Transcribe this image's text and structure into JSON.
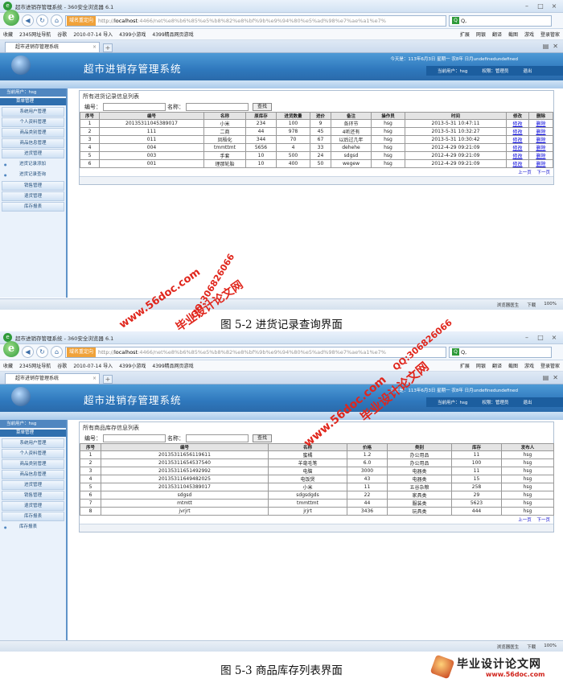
{
  "browser": {
    "window_title": "超市进销存管理系统 - 360安全浏览器 6.1",
    "addr_tag": "域名重定向",
    "addr_prefix": "http://",
    "addr_host": "localhost",
    "addr_path": ":4466/net%e8%b6%85%e5%b8%82%e8%bf%9b%e9%94%80%e5%ad%98%e7%ae%a1%e7%",
    "search_text": "Q,",
    "favorites": [
      "收藏",
      "2345网址导航",
      "谷歌",
      "2010-07-14 导入",
      "4399小游戏",
      "4399精品网页游戏"
    ],
    "toolbar_right": [
      "扩展",
      "网银",
      "翻译",
      "截图",
      "游戏",
      "登录管家"
    ],
    "tab_title": "超市进销存管理系统",
    "status_right": [
      "浏览器医生",
      "下载",
      "100%"
    ]
  },
  "app": {
    "title": "超市进销存管理系统",
    "date_text": "今天是：113年6月3日 星期一 农8年 日月undefinedundefined",
    "current_user": "当前用户：hsg",
    "role": "权限：管理员",
    "logout": "退出",
    "sidebar_head": "当前用户：hsg"
  },
  "shot1": {
    "sidebar": {
      "group": "菜单管理",
      "items_top": [
        "系统用户管理",
        "个人资料管理",
        "商品类别管理",
        "商品信息管理",
        "进货管理"
      ],
      "subs": [
        "进货记录添加",
        "进货记录查询"
      ],
      "items_bottom": [
        "销售管理",
        "退货管理",
        "库存报表"
      ]
    },
    "panel_title": "所有进货记录信息列表",
    "filter_no": "编号：",
    "filter_name": "名称：",
    "search_btn": "查找",
    "headers": [
      "序号",
      "编号",
      "名称",
      "原库存",
      "进货数量",
      "进价",
      "备注",
      "操作员",
      "时间",
      "修改",
      "删除"
    ],
    "rows": [
      [
        "1",
        "20135311045389017",
        "小米",
        "234",
        "100",
        "9",
        "各环节",
        "hsg",
        "2013-5-31 10:47:11",
        "修改",
        "删除"
      ],
      [
        "2",
        "111",
        "二商",
        "44",
        "978",
        "45",
        "4听还有",
        "hsg",
        "2013-5-31 10:32:27",
        "修改",
        "删除"
      ],
      [
        "3",
        "011",
        "凤梧化",
        "344",
        "70",
        "67",
        "以后过几年",
        "hsg",
        "2013-5-31 10:30:42",
        "修改",
        "删除"
      ],
      [
        "4",
        "004",
        "tmmttmt",
        "5656",
        "4",
        "33",
        "dehehe",
        "hsg",
        "2012-4-29 09:21:09",
        "修改",
        "删除"
      ],
      [
        "5",
        "003",
        "手套",
        "10",
        "500",
        "24",
        "sdgsd",
        "hsg",
        "2012-4-29 09:21:09",
        "修改",
        "删除"
      ],
      [
        "6",
        "001",
        "理那轮胎",
        "10",
        "400",
        "50",
        "wegew",
        "hsg",
        "2012-4-29 09:21:09",
        "修改",
        "删除"
      ]
    ],
    "pager": "上一页 下一页",
    "caption": "图 5-2 进货记录查询界面"
  },
  "shot2": {
    "sidebar": {
      "group": "菜单管理",
      "items_top": [
        "系统用户管理",
        "个人资料管理",
        "商品类别管理",
        "商品信息管理",
        "进货管理",
        "销售管理",
        "退货管理",
        "库存报表"
      ],
      "subs": [
        "库存报表"
      ]
    },
    "panel_title": "所有商品库存信息列表",
    "filter_no": "编号：",
    "filter_name": "名称：",
    "search_btn": "查找",
    "headers": [
      "序号",
      "编号",
      "名称",
      "价格",
      "类别",
      "库存",
      "发布人"
    ],
    "rows": [
      [
        "1",
        "20135311656119611",
        "蜜橘",
        "1.2",
        "办公用品",
        "11",
        "hsg"
      ],
      [
        "2",
        "20135311654537540",
        "羊毫毛笔",
        "6.0",
        "办公用品",
        "100",
        "hsg"
      ],
      [
        "3",
        "20135311651492992",
        "电脑",
        "3000",
        "电器类",
        "11",
        "hsg"
      ],
      [
        "4",
        "20135311649482025",
        "电饭煲",
        "43",
        "电器类",
        "15",
        "hsg"
      ],
      [
        "5",
        "20135311045389017",
        "小米",
        "11",
        "五谷杂粮",
        "258",
        "hsg"
      ],
      [
        "6",
        "sdgsd",
        "sdgsdgds",
        "22",
        "家具类",
        "29",
        "hsg"
      ],
      [
        "7",
        "mtmtt",
        "tmmttmt",
        "44",
        "服装类",
        "5623",
        "hsg"
      ],
      [
        "8",
        "jvrjrt",
        "jrjrt",
        "3436",
        "玩具类",
        "444",
        "hsg"
      ]
    ],
    "pager": "上一页 下一页",
    "caption": "图 5-3 商品库存列表界面"
  },
  "watermarks": {
    "site_url": "www.56doc.com",
    "site_name": "毕业设计论文网",
    "qq": "QQ:306826066"
  },
  "footer_logo": {
    "name": "毕业设计论文网",
    "url": "www.56doc.com"
  }
}
